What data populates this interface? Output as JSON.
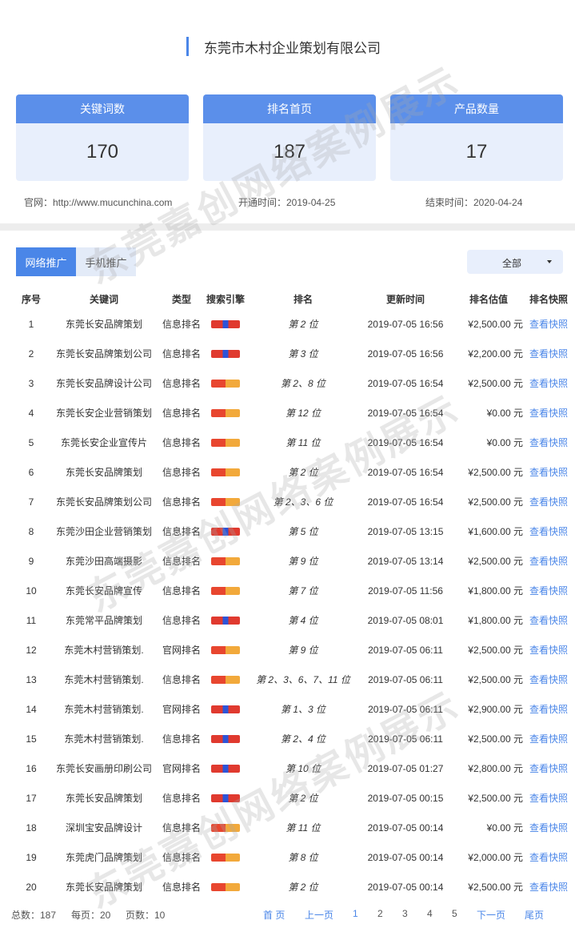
{
  "company": {
    "title": "东莞市木村企业策划有限公司"
  },
  "stats": [
    {
      "label": "关键词数",
      "value": "170"
    },
    {
      "label": "排名首页",
      "value": "187"
    },
    {
      "label": "产品数量",
      "value": "17"
    }
  ],
  "meta": {
    "site": "官网：http://www.mucunchina.com",
    "start": "开通时间：2019-04-25",
    "end": "结束时间：2020-04-24"
  },
  "tabs": [
    {
      "label": "网络推广",
      "active": true
    },
    {
      "label": "手机推广",
      "active": false
    }
  ],
  "filter": {
    "selected": "全部"
  },
  "table": {
    "headers": [
      "序号",
      "关键词",
      "类型",
      "搜索引擎",
      "排名",
      "更新时间",
      "排名估值",
      "排名快照"
    ],
    "rows": [
      {
        "no": "1",
        "keyword": "东莞长安品牌策划",
        "type": "信息排名",
        "engine": "baidu",
        "rank": "第 2 位",
        "time": "2019-07-05 16:56",
        "price": "¥2,500.00 元",
        "snapshot": "查看快照"
      },
      {
        "no": "2",
        "keyword": "东莞长安品牌策划公司",
        "type": "信息排名",
        "engine": "baidu",
        "rank": "第 3 位",
        "time": "2019-07-05 16:56",
        "price": "¥2,200.00 元",
        "snapshot": "查看快照"
      },
      {
        "no": "3",
        "keyword": "东莞长安品牌设计公司",
        "type": "信息排名",
        "engine": "so",
        "rank": "第 2、8 位",
        "time": "2019-07-05 16:54",
        "price": "¥2,500.00 元",
        "snapshot": "查看快照"
      },
      {
        "no": "4",
        "keyword": "东莞长安企业营销策划",
        "type": "信息排名",
        "engine": "so",
        "rank": "第 12 位",
        "time": "2019-07-05 16:54",
        "price": "¥0.00 元",
        "snapshot": "查看快照"
      },
      {
        "no": "5",
        "keyword": "东莞长安企业宣传片",
        "type": "信息排名",
        "engine": "so",
        "rank": "第 11 位",
        "time": "2019-07-05 16:54",
        "price": "¥0.00 元",
        "snapshot": "查看快照"
      },
      {
        "no": "6",
        "keyword": "东莞长安品牌策划",
        "type": "信息排名",
        "engine": "so",
        "rank": "第 2 位",
        "time": "2019-07-05 16:54",
        "price": "¥2,500.00 元",
        "snapshot": "查看快照"
      },
      {
        "no": "7",
        "keyword": "东莞长安品牌策划公司",
        "type": "信息排名",
        "engine": "so",
        "rank": "第 2、3、6 位",
        "time": "2019-07-05 16:54",
        "price": "¥2,500.00 元",
        "snapshot": "查看快照"
      },
      {
        "no": "8",
        "keyword": "东莞沙田企业营销策划",
        "type": "信息排名",
        "engine": "baidu",
        "rank": "第 5 位",
        "time": "2019-07-05 13:15",
        "price": "¥1,600.00 元",
        "snapshot": "查看快照"
      },
      {
        "no": "9",
        "keyword": "东莞沙田高端摄影",
        "type": "信息排名",
        "engine": "so",
        "rank": "第 9 位",
        "time": "2019-07-05 13:14",
        "price": "¥2,500.00 元",
        "snapshot": "查看快照"
      },
      {
        "no": "10",
        "keyword": "东莞长安品牌宣传",
        "type": "信息排名",
        "engine": "so",
        "rank": "第 7 位",
        "time": "2019-07-05 11:56",
        "price": "¥1,800.00 元",
        "snapshot": "查看快照"
      },
      {
        "no": "11",
        "keyword": "东莞常平品牌策划",
        "type": "信息排名",
        "engine": "baidu",
        "rank": "第 4 位",
        "time": "2019-07-05 08:01",
        "price": "¥1,800.00 元",
        "snapshot": "查看快照"
      },
      {
        "no": "12",
        "keyword": "东莞木村营销策划.",
        "type": "官网排名",
        "engine": "so",
        "rank": "第 9 位",
        "time": "2019-07-05 06:11",
        "price": "¥2,500.00 元",
        "snapshot": "查看快照"
      },
      {
        "no": "13",
        "keyword": "东莞木村营销策划.",
        "type": "信息排名",
        "engine": "so",
        "rank": "第 2、3、6、7、11 位",
        "time": "2019-07-05 06:11",
        "price": "¥2,500.00 元",
        "snapshot": "查看快照"
      },
      {
        "no": "14",
        "keyword": "东莞木村营销策划.",
        "type": "官网排名",
        "engine": "baidu",
        "rank": "第 1、3 位",
        "time": "2019-07-05 06:11",
        "price": "¥2,900.00 元",
        "snapshot": "查看快照"
      },
      {
        "no": "15",
        "keyword": "东莞木村营销策划.",
        "type": "信息排名",
        "engine": "baidu",
        "rank": "第 2、4 位",
        "time": "2019-07-05 06:11",
        "price": "¥2,500.00 元",
        "snapshot": "查看快照"
      },
      {
        "no": "16",
        "keyword": "东莞长安画册印刷公司",
        "type": "官网排名",
        "engine": "baidu",
        "rank": "第 10 位",
        "time": "2019-07-05 01:27",
        "price": "¥2,800.00 元",
        "snapshot": "查看快照"
      },
      {
        "no": "17",
        "keyword": "东莞长安品牌策划",
        "type": "信息排名",
        "engine": "baidu",
        "rank": "第 2 位",
        "time": "2019-07-05 00:15",
        "price": "¥2,500.00 元",
        "snapshot": "查看快照"
      },
      {
        "no": "18",
        "keyword": "深圳宝安品牌设计",
        "type": "信息排名",
        "engine": "so",
        "rank": "第 11 位",
        "time": "2019-07-05 00:14",
        "price": "¥0.00 元",
        "snapshot": "查看快照"
      },
      {
        "no": "19",
        "keyword": "东莞虎门品牌策划",
        "type": "信息排名",
        "engine": "so",
        "rank": "第 8 位",
        "time": "2019-07-05 00:14",
        "price": "¥2,000.00 元",
        "snapshot": "查看快照"
      },
      {
        "no": "20",
        "keyword": "东莞长安品牌策划",
        "type": "信息排名",
        "engine": "so",
        "rank": "第 2 位",
        "time": "2019-07-05 00:14",
        "price": "¥2,500.00 元",
        "snapshot": "查看快照"
      }
    ]
  },
  "pager": {
    "total": "总数：187",
    "per_page": "每页：20",
    "pages": "页数：10",
    "first": "首 页",
    "prev": "上一页",
    "numbers": [
      "1",
      "2",
      "3",
      "4",
      "5"
    ],
    "next": "下一页",
    "last": "尾页"
  },
  "watermark": "东莞嘉创网络案例展示",
  "colors": {
    "accent": "#4a86e8",
    "card_head": "#5b8fea",
    "card_body": "#e8effc"
  }
}
